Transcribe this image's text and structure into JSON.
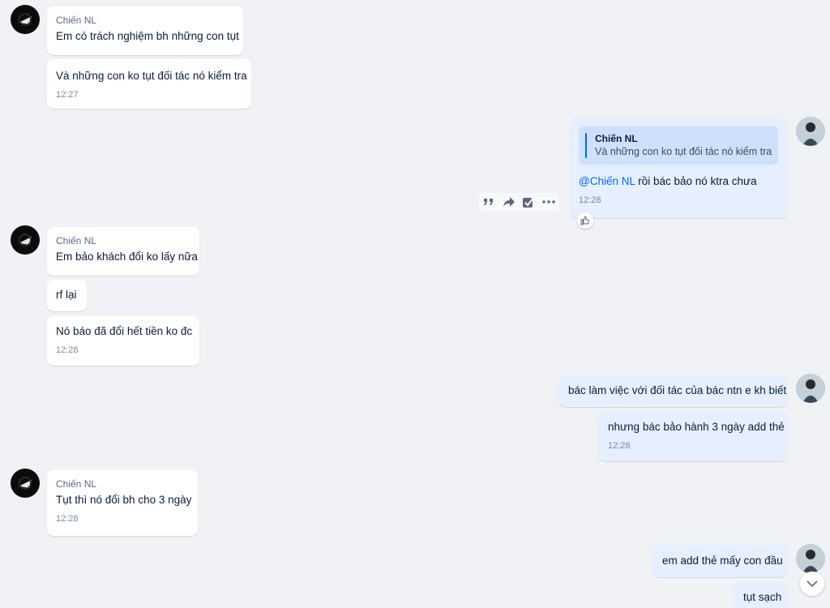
{
  "colors": {
    "background": "#f0f2f5",
    "incoming_bubble": "#ffffff",
    "outgoing_bubble": "#e5efff",
    "mention": "#0068ff"
  },
  "messages": [
    {
      "sender": "Chiến NL",
      "text": "Em có trách nghiệm bh những con tụt"
    },
    {
      "text": "Và những con ko tụt đối tác nó kiểm tra",
      "time": "12:27"
    },
    {
      "quote": {
        "author": "Chiến NL",
        "text": "Và những con ko tụt đối tác nó kiểm tra"
      },
      "mention": "@Chiến NL",
      "text": " rồi bác bảo nó ktra chưa",
      "time": "12:28"
    },
    {
      "sender": "Chiến NL",
      "text": "Em bảo khách đổi ko lấy nữa"
    },
    {
      "text": "rf lại"
    },
    {
      "text": "Nó báo đã đổi hết tiền ko đc",
      "time": "12:28"
    },
    {
      "text": "bác làm việc với đối tác của bác ntn e kh biết"
    },
    {
      "text": "nhưng bác bảo hành 3 ngày add thẻ",
      "time": "12:28"
    },
    {
      "sender": "Chiến NL",
      "text": "Tụt thì nó đổi bh cho 3 ngày",
      "time": "12:28"
    },
    {
      "text": "em add thẻ mấy con đầu"
    },
    {
      "text": "tụt sạch"
    }
  ],
  "icons": {
    "quote": "quote-icon",
    "forward": "forward-icon",
    "task": "task-icon",
    "more": "more-icon",
    "like": "thumbs-up-icon",
    "scroll": "chevron-down-icon"
  }
}
